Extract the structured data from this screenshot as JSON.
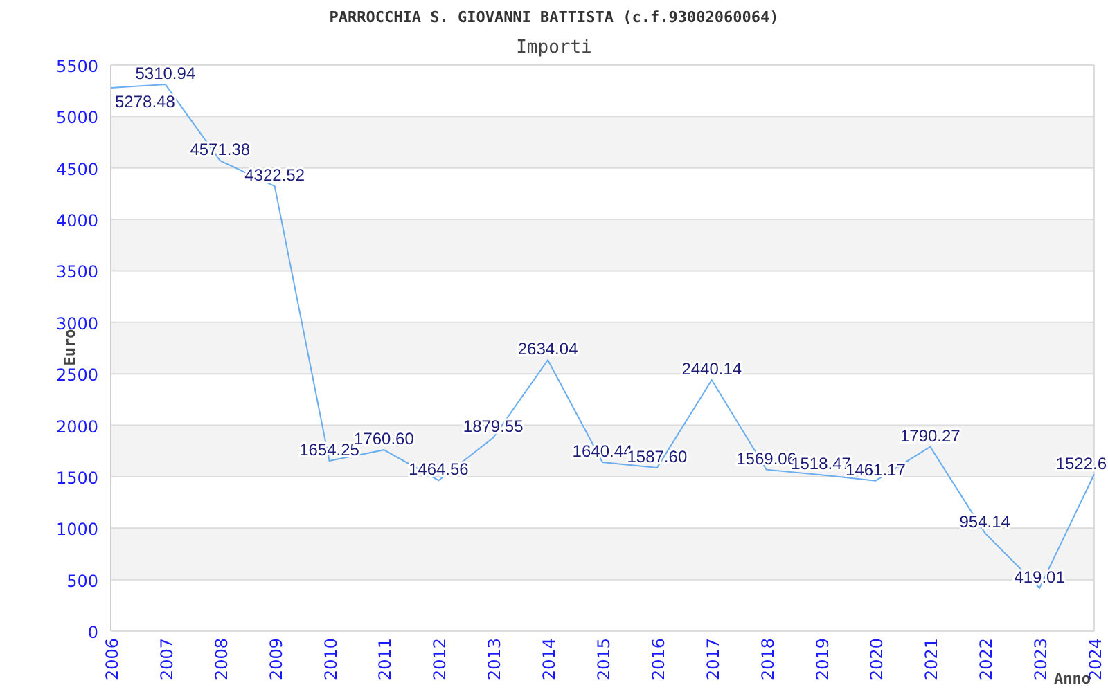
{
  "title": "PARROCCHIA S. GIOVANNI BATTISTA (c.f.93002060064)",
  "chart_data": {
    "type": "line",
    "grid": true,
    "xlabel": "Anno",
    "ylabel": "Euro",
    "categories": [
      "2006",
      "2007",
      "2008",
      "2009",
      "2010",
      "2011",
      "2012",
      "2013",
      "2014",
      "2015",
      "2016",
      "2017",
      "2018",
      "2019",
      "2020",
      "2021",
      "2022",
      "2023",
      "2024"
    ],
    "series": [
      {
        "name": "Importi",
        "color": "#6aaef0",
        "values": [
          5278.48,
          5310.94,
          4571.38,
          4322.52,
          1654.25,
          1760.6,
          1464.56,
          1879.55,
          2634.04,
          1640.44,
          1587.6,
          2440.14,
          1569.06,
          1518.47,
          1461.17,
          1790.27,
          954.14,
          419.01,
          1522.6
        ]
      }
    ],
    "value_labels": [
      "5278.48",
      "5310.94",
      "4571.38",
      "4322.52",
      "1654.25",
      "1760.60",
      "1464.56",
      "1879.55",
      "2634.04",
      "1640.44",
      "1587.60",
      "2440.14",
      "1569.06",
      "1518.47",
      "1461.17",
      "1790.27",
      "954.14",
      "419.01",
      "1522.6"
    ],
    "ylim": [
      0,
      5500
    ],
    "yticks": [
      0,
      500,
      1000,
      1500,
      2000,
      2500,
      3000,
      3500,
      4000,
      4500,
      5000,
      5500
    ]
  }
}
